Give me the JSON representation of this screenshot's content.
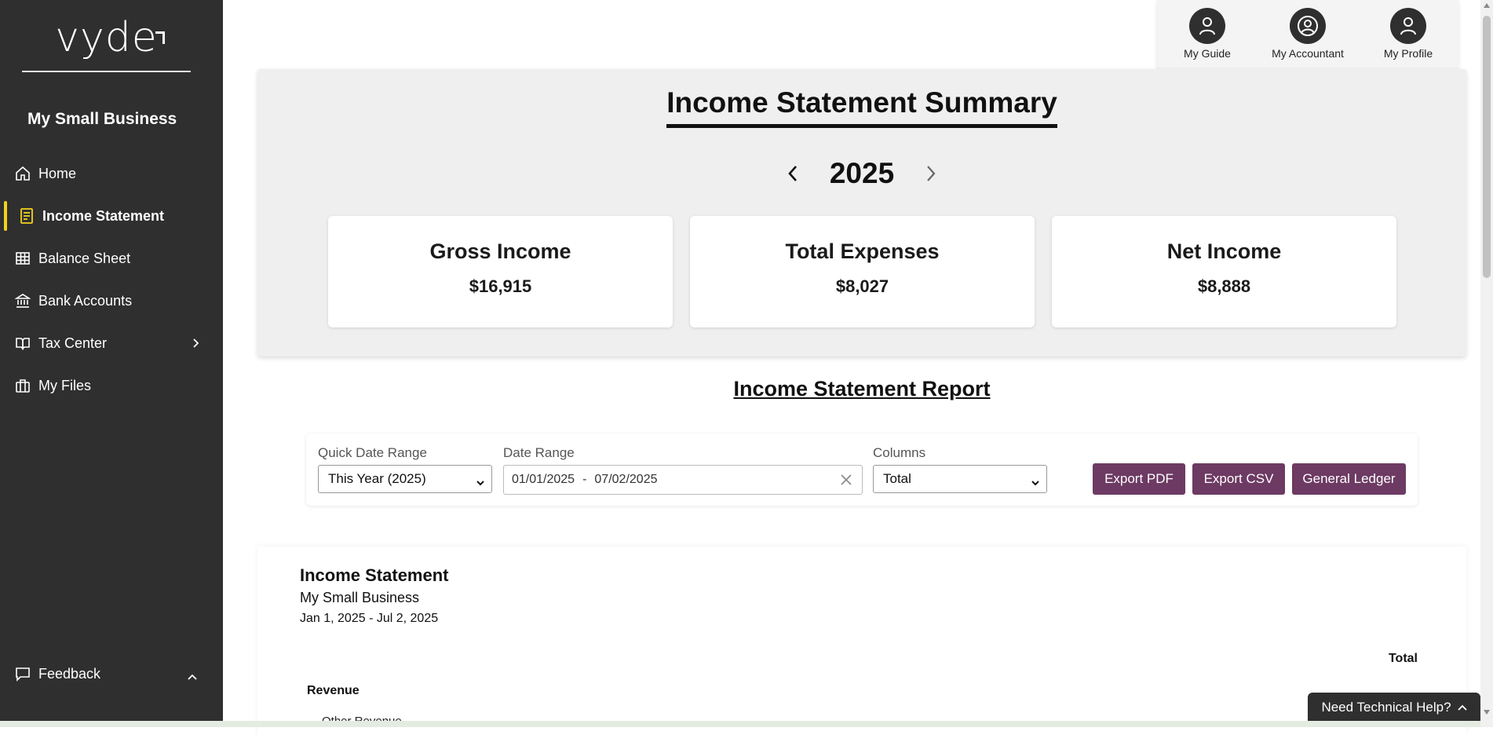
{
  "sidebar": {
    "logo_text": "vyde",
    "business_name": "My Small Business",
    "items": [
      {
        "label": "Home",
        "icon": "home-icon"
      },
      {
        "label": "Income Statement",
        "icon": "document-icon",
        "active": true
      },
      {
        "label": "Balance Sheet",
        "icon": "table-icon"
      },
      {
        "label": "Bank Accounts",
        "icon": "bank-icon"
      },
      {
        "label": "Tax Center",
        "icon": "book-icon",
        "expandable": true
      },
      {
        "label": "My Files",
        "icon": "briefcase-icon"
      }
    ],
    "feedback_label": "Feedback"
  },
  "account_bar": {
    "guide_label": "My Guide",
    "accountant_label": "My Accountant",
    "profile_label": "My Profile"
  },
  "summary": {
    "title": "Income Statement Summary",
    "year": "2025",
    "cards": [
      {
        "title": "Gross Income",
        "value": "$16,915"
      },
      {
        "title": "Total Expenses",
        "value": "$8,027"
      },
      {
        "title": "Net Income",
        "value": "$8,888"
      }
    ]
  },
  "report": {
    "title": "Income Statement Report",
    "quick_date_label": "Quick Date Range",
    "quick_date_value": "This Year (2025)",
    "date_range_label": "Date Range",
    "date_start": "01/01/2025",
    "date_sep": "-",
    "date_end": "07/02/2025",
    "columns_label": "Columns",
    "columns_value": "Total",
    "export_pdf": "Export PDF",
    "export_csv": "Export CSV",
    "general_ledger": "General Ledger"
  },
  "statement": {
    "title": "Income Statement",
    "business": "My Small Business",
    "dates": "Jan 1, 2025 - Jul 2, 2025",
    "total_header": "Total",
    "revenue_label": "Revenue",
    "other_revenue_label": "Other Revenue"
  },
  "help": {
    "label": "Need Technical Help?"
  },
  "colors": {
    "sidebar_bg": "#2f2f2f",
    "accent_active": "#f2d31b",
    "button_bg": "#6d3a63",
    "summary_bg": "#efefef"
  }
}
